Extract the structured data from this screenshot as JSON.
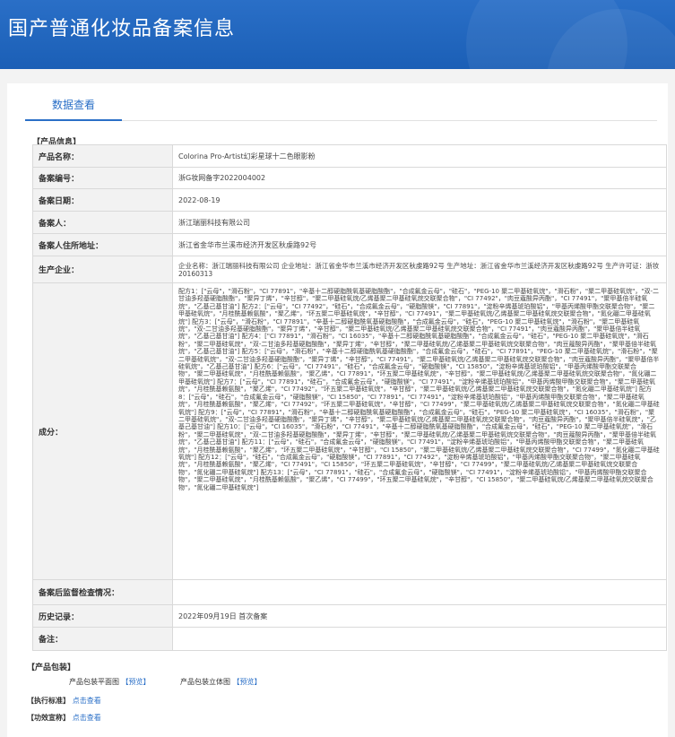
{
  "header": {
    "title": "国产普通化妆品备案信息"
  },
  "tabs": {
    "active": "数据查看"
  },
  "product_info": {
    "section_title": "【产品信息】",
    "rows": [
      {
        "label": "产品名称：",
        "value": "Colorina Pro-Artist幻彩星球十二色眼影粉"
      },
      {
        "label": "备案编号：",
        "value": "浙G妆网备字2022004002"
      },
      {
        "label": "备案日期：",
        "value": "2022-08-19"
      },
      {
        "label": "备案人：",
        "value": "浙江瑞丽科技有限公司"
      },
      {
        "label": "备案人住所地址：",
        "value": "浙江省金华市兰溪市经济开发区秋虔路92号"
      },
      {
        "label": "生产企业：",
        "value": "企业名称：浙江瑞丽科技有限公司 企业地址：浙江省金华市兰溪市经济开发区秋虔路92号 生产地址：浙江省金华市兰溪经济开发区秋虔路92号 生产许可证：浙妆20160313"
      },
      {
        "label": "成分：",
        "value": "配方1：[\"云母\"，\"滑石粉\"，\"CI 77891\"，\"辛基十二醇硬脂酰氧基硬脂酸酯\"，\"合成氟金云母\"，\"硅石\"，\"PEG-10 聚二甲基硅氧烷\"，\"滑石粉\"，\"聚二甲基硅氧烷\"，\"双-二甘油多羟基硬脂酸酯\"，\"聚异丁烯\"，\"辛甘醇\"，\"聚二甲基硅氧烷/乙烯基聚二甲基硅氧烷交联聚合物\"，\"CI 77492\"，\"肉豆蔻酸异丙酯\"，\"CI 77491\"，\"聚甲基倍半硅氧烷\"，\"乙基己基甘油\"] 配方2：[\"云母\"，\"CI 77492\"，\"硅石\"，\"合成氟金云母\"，\"硬脂酸镁\"，\"CI 77891\"，\"淀粉辛烯基琥珀酸铝\"，\"甲基丙烯酸甲酯交联聚合物\"，\"聚二甲基硅氧烷\"，\"月桂酰基赖氨酸\"，\"聚乙烯\"，\"环五聚二甲基硅氧烷\"，\"辛甘醇\"，\"CI 77491\"，\"聚二甲基硅氧烷/乙烯基聚二甲基硅氧烷交联聚合物\"，\"氮化硼二甲基硅氧烷\"] 配方3：[\"云母\"，\"滑石粉\"，\"CI 77891\"，\"辛基十二醇硬脂酰氧基硬脂酸酯\"，\"合成氟金云母\"，\"硅石\"，\"PEG-10 聚二甲基硅氧烷\"，\"滑石粉\"，\"聚二甲基硅氧烷\"，\"双-二甘油多羟基硬脂酸酯\"，\"聚异丁烯\"，\"辛甘醇\"，\"聚二甲基硅氧烷/乙烯基聚二甲基硅氧烷交联聚合物\"，\"CI 77491\"，\"肉豆蔻酸异丙酯\"，\"聚甲基倍半硅氧烷\"，\"乙基己基甘油\"] 配方4：[\"CI 77891\"，\"滑石粉\"，\"CI 16035\"，\"辛基十二醇硬脂酰氧基硬脂酸酯\"，\"合成氟金云母\"，\"硅石\"，\"PEG-10 聚二甲基硅氧烷\"，\"滑石粉\"，\"聚二甲基硅氧烷\"，\"双-二甘油多羟基硬脂酸酯\"，\"聚异丁烯\"，\"辛甘醇\"，\"聚二甲基硅氧烷/乙烯基聚二甲基硅氧烷交联聚合物\"，\"肉豆蔻酸异丙酯\"，\"聚甲基倍半硅氧烷\"，\"乙基己基甘油\"] 配方5：[\"云母\"，\"滑石粉\"，\"辛基十二醇硬脂酰氧基硬脂酸酯\"，\"合成氟金云母\"，\"硅石\"，\"CI 77891\"，\"PEG-10 聚二甲基硅氧烷\"，\"滑石粉\"，\"聚二甲基硅氧烷\"，\"双-二甘油多羟基硬脂酸酯\"，\"聚异丁烯\"，\"辛甘醇\"，\"CI 77491\"，\"聚二甲基硅氧烷/乙烯基聚二甲基硅氧烷交联聚合物\"，\"肉豆蔻酸异丙酯\"，\"聚甲基倍半硅氧烷\"，\"乙基己基甘油\"] 配方6：[\"云母\"，\"CI 77491\"，\"硅石\"，\"合成氟金云母\"，\"硬脂酸镁\"，\"CI 15850\"，\"淀粉辛烯基琥珀酸铝\"，\"甲基丙烯酸甲酯交联聚合物\"，\"聚二甲基硅氧烷\"，\"月桂酰基赖氨酸\"，\"聚乙烯\"，\"CI 77891\"，\"环五聚二甲基硅氧烷\"，\"辛甘醇\"，\"聚二甲基硅氧烷/乙烯基聚二甲基硅氧烷交联聚合物\"，\"氮化硼二甲基硅氧烷\"] 配方7：[\"云母\"，\"CI 77891\"，\"硅石\"，\"合成氟金云母\"，\"硬脂酸镁\"，\"CI 77491\"，\"淀粉辛烯基琥珀酸铝\"，\"甲基丙烯酸甲酯交联聚合物\"，\"聚二甲基硅氧烷\"，\"月桂酰基赖氨酸\"，\"聚乙烯\"，\"CI 77492\"，\"环五聚二甲基硅氧烷\"，\"辛甘醇\"，\"聚二甲基硅氧烷/乙烯基聚二甲基硅氧烷交联聚合物\"，\"氮化硼二甲基硅氧烷\"] 配方8：[\"云母\"，\"硅石\"，\"合成氟金云母\"，\"硬脂酸镁\"，\"CI 15850\"，\"CI 77891\"，\"CI 77491\"，\"淀粉辛烯基琥珀酸铝\"，\"甲基丙烯酸甲酯交联聚合物\"，\"聚二甲基硅氧烷\"，\"月桂酰基赖氨酸\"，\"聚乙烯\"，\"CI 77492\"，\"环五聚二甲基硅氧烷\"，\"辛甘醇\"，\"CI 77499\"，\"聚二甲基硅氧烷/乙烯基聚二甲基硅氧烷交联聚合物\"，\"氮化硼二甲基硅氧烷\"] 配方9：[\"云母\"，\"CI 77891\"，\"滑石粉\"，\"辛基十二醇硬脂酰氧基硬脂酸酯\"，\"合成氟金云母\"，\"硅石\"，\"PEG-10 聚二甲基硅氧烷\"，\"CI 16035\"，\"滑石粉\"，\"聚二甲基硅氧烷\"，\"双-二甘油多羟基硬脂酸酯\"，\"聚异丁烯\"，\"辛甘醇\"，\"聚二甲基硅氧烷/乙烯基聚二甲基硅氧烷交联聚合物\"，\"肉豆蔻酸异丙酯\"，\"聚甲基倍半硅氧烷\"，\"乙基己基甘油\"] 配方10：[\"云母\"，\"CI 16035\"，\"滑石粉\"，\"CI 77491\"，\"辛基十二醇硬脂酰氧基硬脂酸酯\"，\"合成氟金云母\"，\"硅石\"，\"PEG-10 聚二甲基硅氧烷\"，\"滑石粉\"，\"聚二甲基硅氧烷\"，\"双-二甘油多羟基硬脂酸酯\"，\"聚异丁烯\"，\"辛甘醇\"，\"聚二甲基硅氧烷/乙烯基聚二甲基硅氧烷交联聚合物\"，\"肉豆蔻酸异丙酯\"，\"聚甲基倍半硅氧烷\"，\"乙基己基甘油\"] 配方11：[\"云母\"，\"硅石\"，\"合成氟金云母\"，\"硬脂酸镁\"，\"CI 77491\"，\"淀粉辛烯基琥珀酸铝\"，\"甲基丙烯酸甲酯交联聚合物\"，\"聚二甲基硅氧烷\"，\"月桂酰基赖氨酸\"，\"聚乙烯\"，\"环五聚二甲基硅氧烷\"，\"辛甘醇\"，\"CI 15850\"，\"聚二甲基硅氧烷/乙烯基聚二甲基硅氧烷交联聚合物\"，\"CI 77499\"，\"氮化硼二甲基硅氧烷\"] 配方12：[\"云母\"，\"硅石\"，\"合成氟金云母\"，\"硬脂酸镁\"，\"CI 77891\"，\"CI 77492\"，\"淀粉辛烯基琥珀酸铝\"，\"甲基丙烯酸甲酯交联聚合物\"，\"聚二甲基硅氧烷\"，\"月桂酰基赖氨酸\"，\"聚乙烯\"，\"CI 77491\"，\"CI 15850\"，\"环五聚二甲基硅氧烷\"，\"辛甘醇\"，\"CI 77499\"，\"聚二甲基硅氧烷/乙烯基聚二甲基硅氧烷交联聚合物\"，\"氮化硼二甲基硅氧烷\"] 配方13：[\"云母\"，\"CI 77891\"，\"硅石\"，\"合成氟金云母\"，\"硬脂酸镁\"，\"CI 77491\"，\"淀粉辛烯基琥珀酸铝\"，\"甲基丙烯酸甲酯交联聚合物\"，\"聚二甲基硅氧烷\"，\"月桂酰基赖氨酸\"，\"聚乙烯\"，\"CI 77499\"，\"环五聚二甲基硅氧烷\"，\"辛甘醇\"，\"CI 15850\"，\"聚二甲基硅氧烷/乙烯基聚二甲基硅氧烷交联聚合物\"，\"氮化硼二甲基硅氧烷\"]"
      },
      {
        "label": "备案后监督检查情况：",
        "value": ""
      },
      {
        "label": "历史记录：",
        "value": "2022年09月19日 首次备案"
      },
      {
        "label": "备注：",
        "value": ""
      }
    ]
  },
  "packaging": {
    "section_title": "【产品包装】",
    "flat_label": "产品包装平面图",
    "flat_link": "【预览】",
    "solid_label": "产品包装立体图",
    "solid_link": "【预览】"
  },
  "standard": {
    "section_title": "【执行标准】",
    "link": "点击查看"
  },
  "efficacy": {
    "section_title": "【功效宣称】",
    "link": "点击查看"
  }
}
